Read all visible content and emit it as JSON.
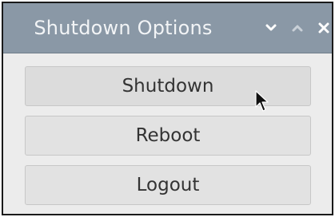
{
  "window": {
    "title": "Shutdown Options",
    "controls": {
      "minimize": "chevron-down-icon",
      "maximize": "chevron-up-icon",
      "close": "close-icon"
    }
  },
  "buttons": [
    {
      "label": "Shutdown"
    },
    {
      "label": "Reboot"
    },
    {
      "label": "Logout"
    }
  ],
  "colors": {
    "titlebar": "#8a98a6",
    "title_text": "#f2f4f6",
    "content_bg": "#ececec",
    "button_bg": "#e2e2e2",
    "button_text": "#333333"
  }
}
